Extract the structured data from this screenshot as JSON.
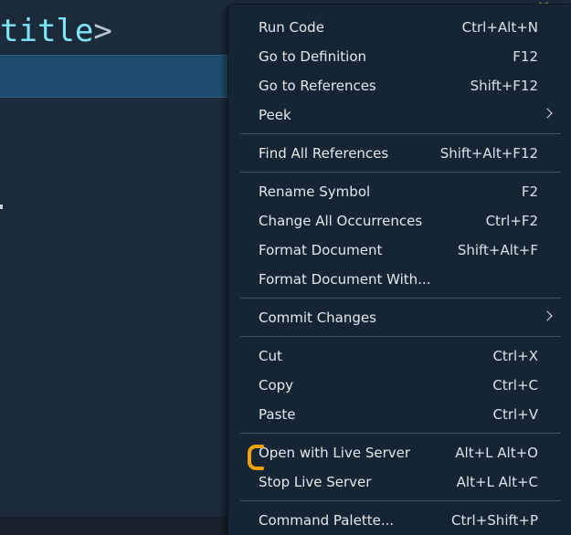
{
  "editor": {
    "code_fragment": {
      "tag_name": "title",
      "close_bracket": ">"
    }
  },
  "menu": {
    "groups": [
      [
        {
          "label": "Run Code",
          "shortcut": "Ctrl+Alt+N"
        },
        {
          "label": "Go to Definition",
          "shortcut": "F12"
        },
        {
          "label": "Go to References",
          "shortcut": "Shift+F12"
        },
        {
          "label": "Peek",
          "shortcut": "",
          "submenu": true
        }
      ],
      [
        {
          "label": "Find All References",
          "shortcut": "Shift+Alt+F12"
        }
      ],
      [
        {
          "label": "Rename Symbol",
          "shortcut": "F2"
        },
        {
          "label": "Change All Occurrences",
          "shortcut": "Ctrl+F2"
        },
        {
          "label": "Format Document",
          "shortcut": "Shift+Alt+F"
        },
        {
          "label": "Format Document With...",
          "shortcut": ""
        }
      ],
      [
        {
          "label": "Commit Changes",
          "shortcut": "",
          "submenu": true
        }
      ],
      [
        {
          "label": "Cut",
          "shortcut": "Ctrl+X"
        },
        {
          "label": "Copy",
          "shortcut": "Ctrl+C"
        },
        {
          "label": "Paste",
          "shortcut": "Ctrl+V"
        }
      ],
      [
        {
          "label": "Open with Live Server",
          "shortcut": "Alt+L Alt+O",
          "highlighted": true
        },
        {
          "label": "Stop Live Server",
          "shortcut": "Alt+L Alt+C"
        }
      ],
      [
        {
          "label": "Command Palette...",
          "shortcut": "Ctrl+Shift+P"
        }
      ]
    ]
  },
  "colors": {
    "editor_background": "#1b2b3c",
    "menu_background": "#162534",
    "current_line": "#1f4d6d",
    "tag_name": "#7ee6f5",
    "cursor_highlight": "#f5a10c"
  }
}
